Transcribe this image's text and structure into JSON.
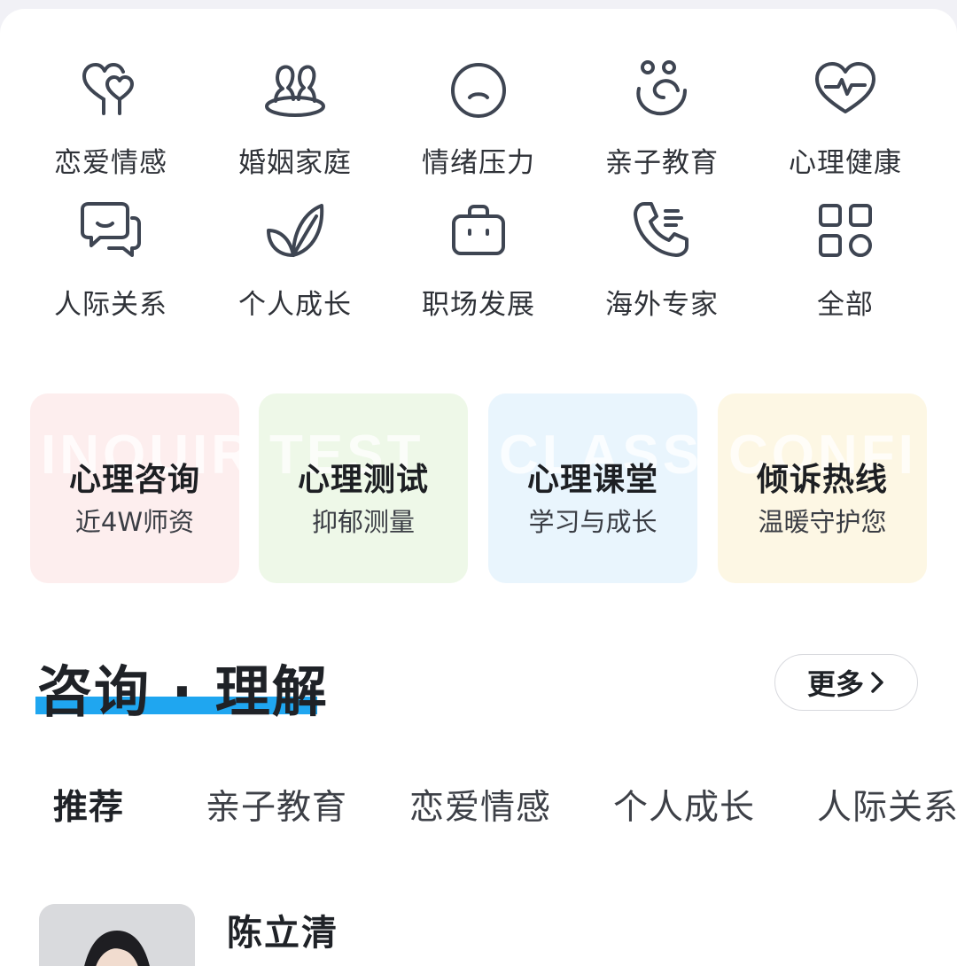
{
  "categories": [
    {
      "label": "恋爱情感",
      "icon": "hearts-balloon-icon"
    },
    {
      "label": "婚姻家庭",
      "icon": "couple-icon"
    },
    {
      "label": "情绪压力",
      "icon": "sad-face-icon"
    },
    {
      "label": "亲子教育",
      "icon": "parent-child-icon"
    },
    {
      "label": "心理健康",
      "icon": "heartbeat-icon"
    },
    {
      "label": "人际关系",
      "icon": "chat-bubbles-icon"
    },
    {
      "label": "个人成长",
      "icon": "sprout-leaves-icon"
    },
    {
      "label": "职场发展",
      "icon": "briefcase-icon"
    },
    {
      "label": "海外专家",
      "icon": "phone-call-icon"
    },
    {
      "label": "全部",
      "icon": "grid-all-icon"
    }
  ],
  "services": [
    {
      "title": "心理咨询",
      "subtitle": "近4W师资",
      "watermark": "INQUIRY",
      "bg": "#fdeeee"
    },
    {
      "title": "心理测试",
      "subtitle": "抑郁测量",
      "watermark": "TEST",
      "bg": "#eef8e8"
    },
    {
      "title": "心理课堂",
      "subtitle": "学习与成长",
      "watermark": "CLASS",
      "bg": "#e9f5fd"
    },
    {
      "title": "倾诉热线",
      "subtitle": "温暖守护您",
      "watermark": "CONFI",
      "bg": "#fdf7e4"
    }
  ],
  "section": {
    "title": "咨询 · 理解",
    "more_label": "更多",
    "accent": "#1fa6f0"
  },
  "tabs": [
    {
      "label": "推荐",
      "active": true
    },
    {
      "label": "亲子教育",
      "active": false
    },
    {
      "label": "恋爱情感",
      "active": false
    },
    {
      "label": "个人成长",
      "active": false
    },
    {
      "label": "人际关系",
      "active": false
    }
  ],
  "expert": {
    "name": "陈立清"
  }
}
